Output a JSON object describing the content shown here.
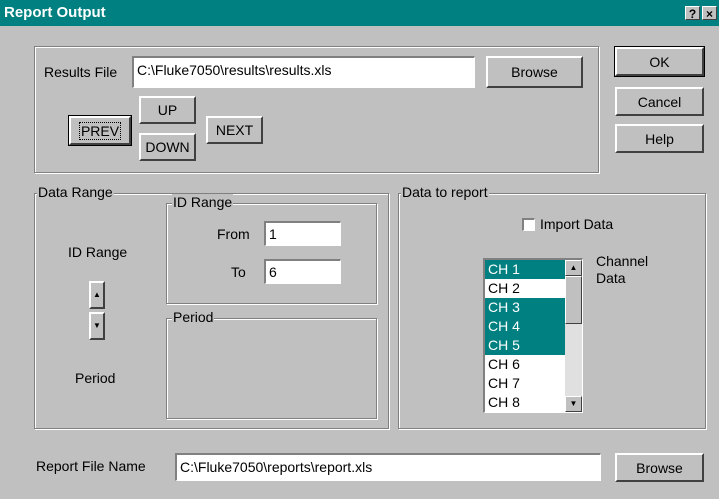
{
  "window": {
    "title": "Report Output",
    "help_label": "?",
    "close_label": "×"
  },
  "results": {
    "label": "Results File",
    "value": "C:\\Fluke7050\\results\\results.xls",
    "browse_label": "Browse",
    "prev_label": "PREV",
    "up_label": "UP",
    "down_label": "DOWN",
    "next_label": "NEXT"
  },
  "buttons": {
    "ok": "OK",
    "cancel": "Cancel",
    "help": "Help"
  },
  "data_range": {
    "group_label": "Data Range",
    "id_range_label": "ID Range",
    "period_label": "Period",
    "spin_up": "▲",
    "spin_down": "▼",
    "id_range_group_label": "ID Range",
    "from_label": "From",
    "from_value": "1",
    "to_label": "To",
    "to_value": "6",
    "period_group_label": "Period"
  },
  "data_to_report": {
    "group_label": "Data to report",
    "import_data_label": "Import Data",
    "import_data_checked": false,
    "channel_data_label_1": "Channel",
    "channel_data_label_2": "Data",
    "scroll_up": "▲",
    "scroll_down": "▼",
    "channels": [
      {
        "label": "CH 1",
        "selected": true
      },
      {
        "label": "CH 2",
        "selected": false
      },
      {
        "label": "CH 3",
        "selected": true
      },
      {
        "label": "CH 4",
        "selected": true
      },
      {
        "label": "CH 5",
        "selected": true
      },
      {
        "label": "CH 6",
        "selected": false
      },
      {
        "label": "CH 7",
        "selected": false
      },
      {
        "label": "CH 8",
        "selected": false
      }
    ]
  },
  "report_file": {
    "label": "Report File Name",
    "value": "C:\\Fluke7050\\reports\\report.xls",
    "browse_label": "Browse"
  },
  "colors": {
    "titlebar": "#008080",
    "selection": "#008080",
    "face": "#c0c0c0"
  }
}
